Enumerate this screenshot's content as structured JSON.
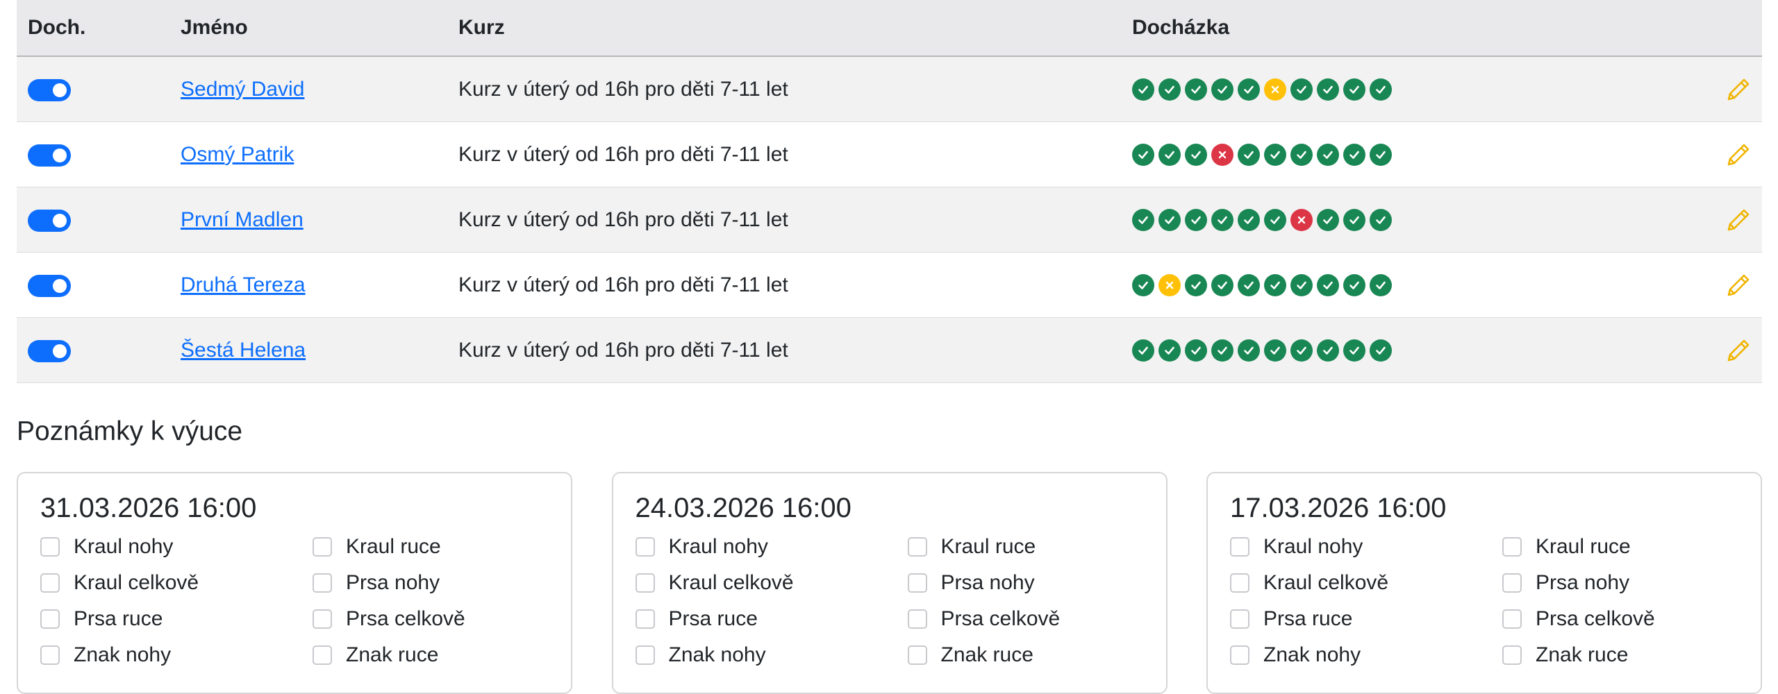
{
  "table": {
    "headers": {
      "toggle": "Doch.",
      "name": "Jméno",
      "course": "Kurz",
      "attendance": "Docházka"
    },
    "rows": [
      {
        "name": "Sedmý David",
        "course": "Kurz v úterý od 16h pro děti 7-11 let",
        "enabled": true,
        "attendance": [
          "ok",
          "ok",
          "ok",
          "ok",
          "ok",
          "excused",
          "ok",
          "ok",
          "ok",
          "ok"
        ]
      },
      {
        "name": "Osmý Patrik",
        "course": "Kurz v úterý od 16h pro děti 7-11 let",
        "enabled": true,
        "attendance": [
          "ok",
          "ok",
          "ok",
          "absent",
          "ok",
          "ok",
          "ok",
          "ok",
          "ok",
          "ok"
        ]
      },
      {
        "name": "První Madlen",
        "course": "Kurz v úterý od 16h pro děti 7-11 let",
        "enabled": true,
        "attendance": [
          "ok",
          "ok",
          "ok",
          "ok",
          "ok",
          "ok",
          "absent",
          "ok",
          "ok",
          "ok"
        ]
      },
      {
        "name": "Druhá Tereza",
        "course": "Kurz v úterý od 16h pro děti 7-11 let",
        "enabled": true,
        "attendance": [
          "ok",
          "excused",
          "ok",
          "ok",
          "ok",
          "ok",
          "ok",
          "ok",
          "ok",
          "ok"
        ]
      },
      {
        "name": "Šestá Helena",
        "course": "Kurz v úterý od 16h pro děti 7-11 let",
        "enabled": true,
        "attendance": [
          "ok",
          "ok",
          "ok",
          "ok",
          "ok",
          "ok",
          "ok",
          "ok",
          "ok",
          "ok"
        ]
      }
    ]
  },
  "notes": {
    "title": "Poznámky k výuce",
    "cards": [
      {
        "date": "31.03.2026 16:00",
        "items": [
          "Kraul nohy",
          "Kraul ruce",
          "Kraul celkově",
          "Prsa nohy",
          "Prsa ruce",
          "Prsa celkově",
          "Znak nohy",
          "Znak ruce"
        ]
      },
      {
        "date": "24.03.2026 16:00",
        "items": [
          "Kraul nohy",
          "Kraul ruce",
          "Kraul celkově",
          "Prsa nohy",
          "Prsa ruce",
          "Prsa celkově",
          "Znak nohy",
          "Znak ruce"
        ]
      },
      {
        "date": "17.03.2026 16:00",
        "items": [
          "Kraul nohy",
          "Kraul ruce",
          "Kraul celkově",
          "Prsa nohy",
          "Prsa ruce",
          "Prsa celkově",
          "Znak nohy",
          "Znak ruce"
        ]
      }
    ]
  },
  "colors": {
    "present": "#198754",
    "excused": "#ffc107",
    "absent": "#dc3545",
    "accent": "#0d6efd",
    "edit": "#f0b400"
  },
  "icons": {
    "present": "check-icon",
    "excused": "x-icon",
    "absent": "x-icon",
    "edit": "pencil-icon",
    "toggle": "toggle-switch-icon"
  }
}
